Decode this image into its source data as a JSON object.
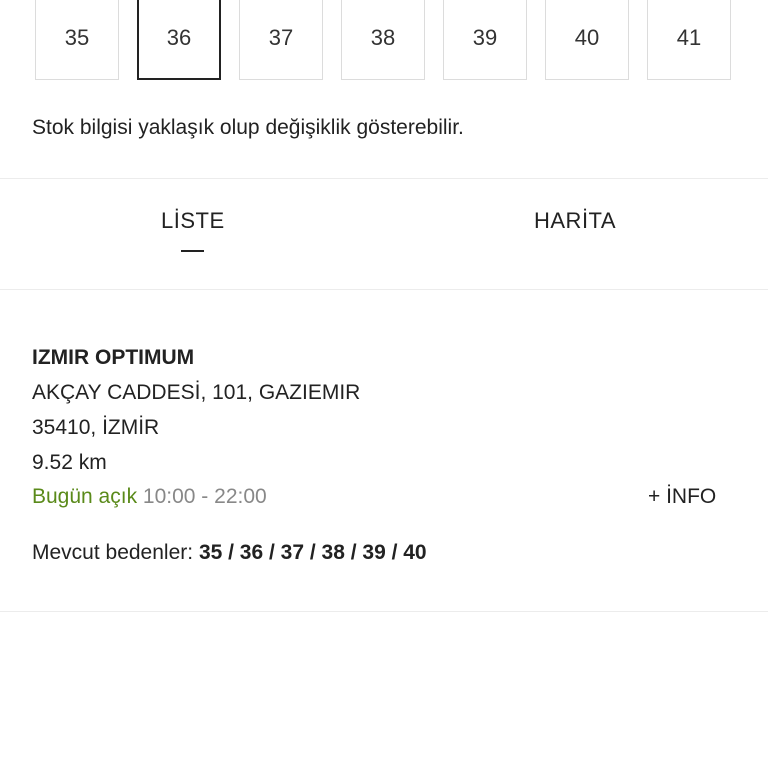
{
  "sizes": [
    "35",
    "36",
    "37",
    "38",
    "39",
    "40",
    "41"
  ],
  "selected_size": "36",
  "stock_note": "Stok bilgisi yaklaşık olup değişiklik gösterebilir.",
  "tabs": {
    "list": "LİSTE",
    "map": "HARİTA",
    "active": "LİSTE"
  },
  "store": {
    "name": "IZMIR OPTIMUM",
    "address_line1": "AKÇAY CADDESİ, 101, GAZIEMIR",
    "address_line2": "35410, İZMİR",
    "distance": "9.52 km",
    "open_status": "Bugün açık",
    "hours": "10:00 - 22:00",
    "info_label": "+ İNFO",
    "available_label": "Mevcut bedenler:",
    "available_sizes": "35 / 36 / 37 / 38 / 39 / 40"
  },
  "colors": {
    "open_status": "#5a8a1a",
    "hours": "#888888",
    "border": "#dcdcdc"
  }
}
